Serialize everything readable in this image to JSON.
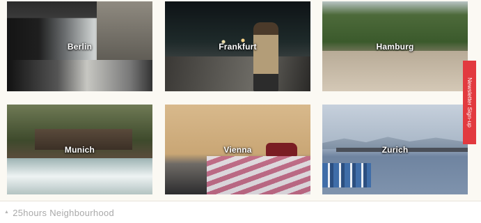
{
  "cities": [
    {
      "name": "Berlin"
    },
    {
      "name": "Frankfurt"
    },
    {
      "name": "Hamburg"
    },
    {
      "name": "Munich"
    },
    {
      "name": "Vienna"
    },
    {
      "name": "Zurich"
    }
  ],
  "newsletter": {
    "label": "Newsletter Sign-up"
  },
  "footer": {
    "icon": "triangle-up-icon",
    "label": "25hours Neighbourhood"
  },
  "colors": {
    "accent": "#e23a3f",
    "panel": "#fbf9f3",
    "footer_text": "#a9a9a9"
  }
}
